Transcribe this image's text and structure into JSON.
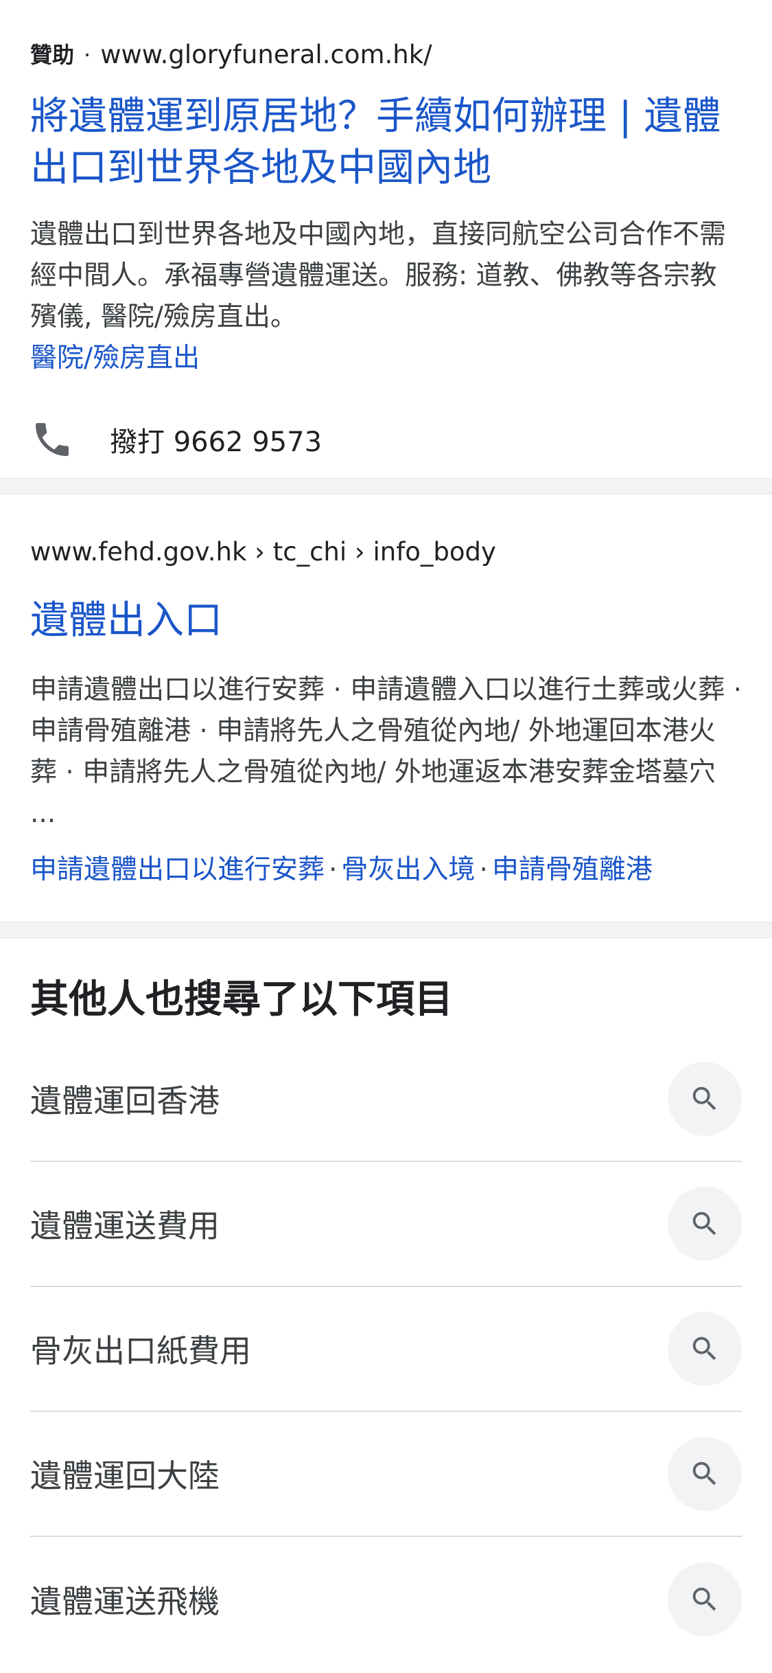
{
  "ad_result": {
    "ad_label": "贊助",
    "dot": "·",
    "url": "www.gloryfuneral.com.hk/",
    "title": "將遺體運到原居地？手續如何辦理 | 遺體出口到世界各地及中國內地",
    "snippet": "遺體出口到世界各地及中國內地，直接同航空公司合作不需經中間人。承福專營遺體運送。服務: 道教、佛教等各宗教殯儀, 醫院/殮房直出。",
    "sitelink": "醫院/殮房直出",
    "call_label": "撥打 9662 9573",
    "call_icon": "phone-icon"
  },
  "organic_result": {
    "breadcrumb": "www.fehd.gov.hk › tc_chi › info_body",
    "title": "遺體出入口",
    "snippet": "申請遺體出口以進行安葬 · 申請遺體入口以進行土葬或火葬 · 申請骨殖離港 · 申請將先人之骨殖從內地/ 外地運回本港火葬 · 申請將先人之骨殖從內地/ 外地運返本港安葬金塔墓穴 ...",
    "sitelinks": [
      "申請遺體出口以進行安葬",
      "骨灰出入境",
      "申請骨殖離港"
    ],
    "sitelink_separator": "·"
  },
  "related": {
    "heading": "其他人也搜尋了以下項目",
    "items": [
      {
        "label": "遺體運回香港",
        "icon": "search-icon"
      },
      {
        "label": "遺體運送費用",
        "icon": "search-icon"
      },
      {
        "label": "骨灰出口紙費用",
        "icon": "search-icon"
      },
      {
        "label": "遺體運回大陸",
        "icon": "search-icon"
      },
      {
        "label": "遺體運送飛機",
        "icon": "search-icon"
      }
    ]
  },
  "colors": {
    "link_blue": "#1a56c9",
    "text_dark": "#202124",
    "text_body": "#3c4043",
    "divider_gray": "#f1f3f4",
    "icon_gray": "#5f6368"
  }
}
